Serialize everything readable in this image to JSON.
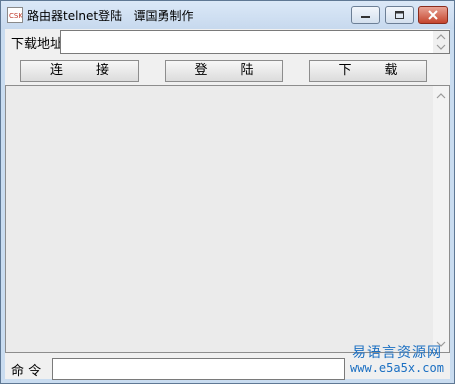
{
  "window": {
    "title": "路由器telnet登陆   谭国勇制作",
    "controls": {
      "minimize": "minimize",
      "maximize": "maximize",
      "close": "close"
    }
  },
  "download": {
    "label": "下载地址",
    "value": ""
  },
  "buttons": {
    "connect": "连        接",
    "login": "登        陆",
    "download": "下        载"
  },
  "output": {
    "text": ""
  },
  "command": {
    "label": "命 令",
    "value": ""
  },
  "watermark": {
    "line1": "易语言资源网",
    "line2": "www.e5a5x.com"
  },
  "colors": {
    "titlebar": "#c9dcf0",
    "close_button": "#c5452e",
    "watermark": "#1b6fc2"
  }
}
